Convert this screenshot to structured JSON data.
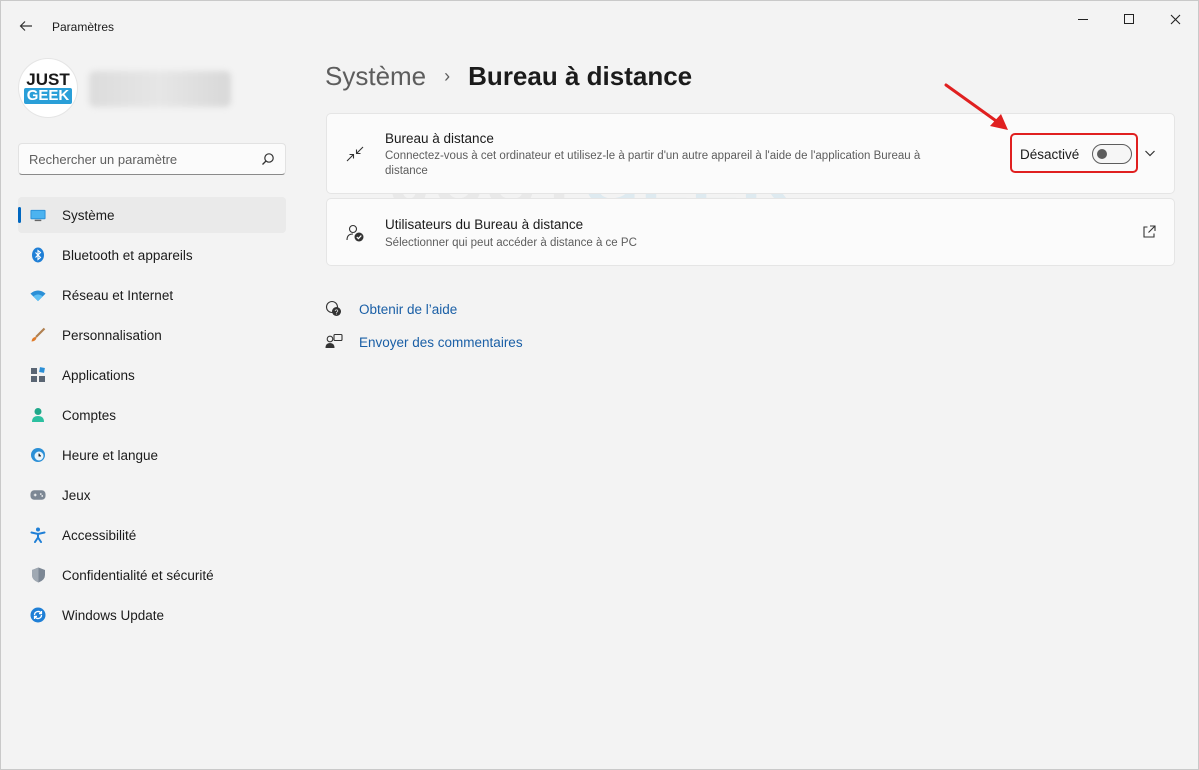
{
  "window": {
    "title": "Paramètres"
  },
  "profile": {
    "logo_top": "JUST",
    "logo_bottom": "GEEK"
  },
  "search": {
    "placeholder": "Rechercher un paramètre"
  },
  "sidebar": {
    "items": [
      {
        "label": "Système",
        "icon": "system-display-icon",
        "selected": true
      },
      {
        "label": "Bluetooth et appareils",
        "icon": "bluetooth-icon"
      },
      {
        "label": "Réseau et Internet",
        "icon": "wifi-icon"
      },
      {
        "label": "Personnalisation",
        "icon": "paintbrush-icon"
      },
      {
        "label": "Applications",
        "icon": "apps-icon"
      },
      {
        "label": "Comptes",
        "icon": "account-icon"
      },
      {
        "label": "Heure et langue",
        "icon": "clock-globe-icon"
      },
      {
        "label": "Jeux",
        "icon": "gamepad-icon"
      },
      {
        "label": "Accessibilité",
        "icon": "accessibility-icon"
      },
      {
        "label": "Confidentialité et sécurité",
        "icon": "shield-icon"
      },
      {
        "label": "Windows Update",
        "icon": "update-icon"
      }
    ]
  },
  "breadcrumb": {
    "parent": "Système",
    "separator": "›",
    "current": "Bureau à distance"
  },
  "remote_desktop": {
    "title": "Bureau à distance",
    "description": "Connectez-vous à cet ordinateur et utilisez-le à partir d'un autre appareil à l'aide de l'application Bureau à distance",
    "toggle_label": "Désactivé",
    "enabled": false
  },
  "remote_users": {
    "title": "Utilisateurs du Bureau à distance",
    "description": "Sélectionner qui peut accéder à distance à ce PC"
  },
  "links": {
    "help": "Obtenir de l’aide",
    "feedback": "Envoyer des commentaires"
  },
  "watermark": {
    "part1": "JUST",
    "part2": "GEEK"
  },
  "colors": {
    "accent": "#0067c0",
    "link": "#1a5fa6",
    "annotation": "#e02020",
    "logo_blue": "#2a9fd8"
  }
}
